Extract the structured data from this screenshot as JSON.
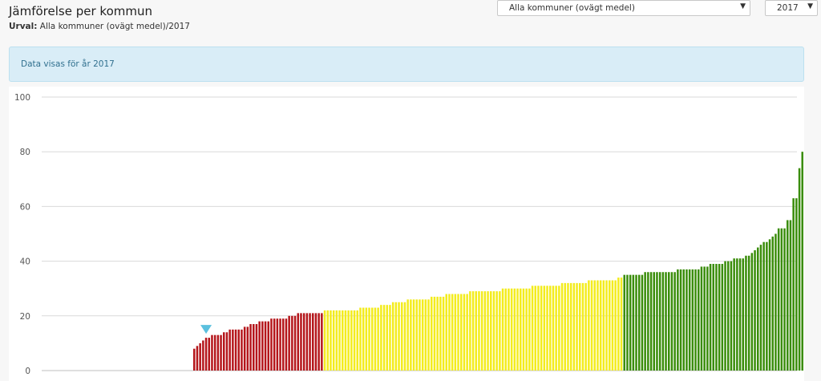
{
  "header": {
    "title": "Jämförelse per kommun",
    "urval_label": "Urval:",
    "urval_value": "Alla kommuner (ovägt medel)/2017"
  },
  "controls": {
    "kommun_select": "Alla kommuner (ovägt medel)",
    "year_select": "2017"
  },
  "info_text": "Data visas för år 2017",
  "colors": {
    "red": "#b5161b",
    "yellow": "#f3ec1d",
    "green": "#3a8d0a",
    "marker": "#5bc0de",
    "grid": "#d9d9d9"
  },
  "chart_data": {
    "type": "bar",
    "ylim": [
      0,
      100
    ],
    "yticks": [
      0,
      20,
      40,
      60,
      80,
      100
    ],
    "grid": true,
    "marker_index": 4,
    "groups": [
      {
        "color": "red",
        "values": [
          8,
          9,
          10,
          11,
          12,
          12,
          13,
          13,
          13,
          13,
          14,
          14,
          15,
          15,
          15,
          15,
          15,
          16,
          16,
          17,
          17,
          17,
          18,
          18,
          18,
          18,
          19,
          19,
          19,
          19,
          19,
          19,
          20,
          20,
          20,
          21,
          21,
          21,
          21,
          21,
          21,
          21,
          21,
          21
        ]
      },
      {
        "color": "yellow",
        "values": [
          22,
          22,
          22,
          22,
          22,
          22,
          22,
          22,
          22,
          22,
          22,
          22,
          23,
          23,
          23,
          23,
          23,
          23,
          23,
          24,
          24,
          24,
          24,
          25,
          25,
          25,
          25,
          25,
          26,
          26,
          26,
          26,
          26,
          26,
          26,
          26,
          27,
          27,
          27,
          27,
          27,
          28,
          28,
          28,
          28,
          28,
          28,
          28,
          28,
          29,
          29,
          29,
          29,
          29,
          29,
          29,
          29,
          29,
          29,
          29,
          30,
          30,
          30,
          30,
          30,
          30,
          30,
          30,
          30,
          30,
          31,
          31,
          31,
          31,
          31,
          31,
          31,
          31,
          31,
          31,
          32,
          32,
          32,
          32,
          32,
          32,
          32,
          32,
          32,
          33,
          33,
          33,
          33,
          33,
          33,
          33,
          33,
          33,
          33,
          34,
          34
        ]
      },
      {
        "color": "green",
        "values": [
          35,
          35,
          35,
          35,
          35,
          35,
          35,
          36,
          36,
          36,
          36,
          36,
          36,
          36,
          36,
          36,
          36,
          36,
          37,
          37,
          37,
          37,
          37,
          37,
          37,
          37,
          38,
          38,
          38,
          39,
          39,
          39,
          39,
          39,
          40,
          40,
          40,
          41,
          41,
          41,
          41,
          42,
          42,
          43,
          44,
          45,
          46,
          47,
          47,
          48,
          49,
          50,
          52,
          52,
          52,
          55,
          55,
          63,
          63,
          74,
          80
        ]
      }
    ]
  }
}
